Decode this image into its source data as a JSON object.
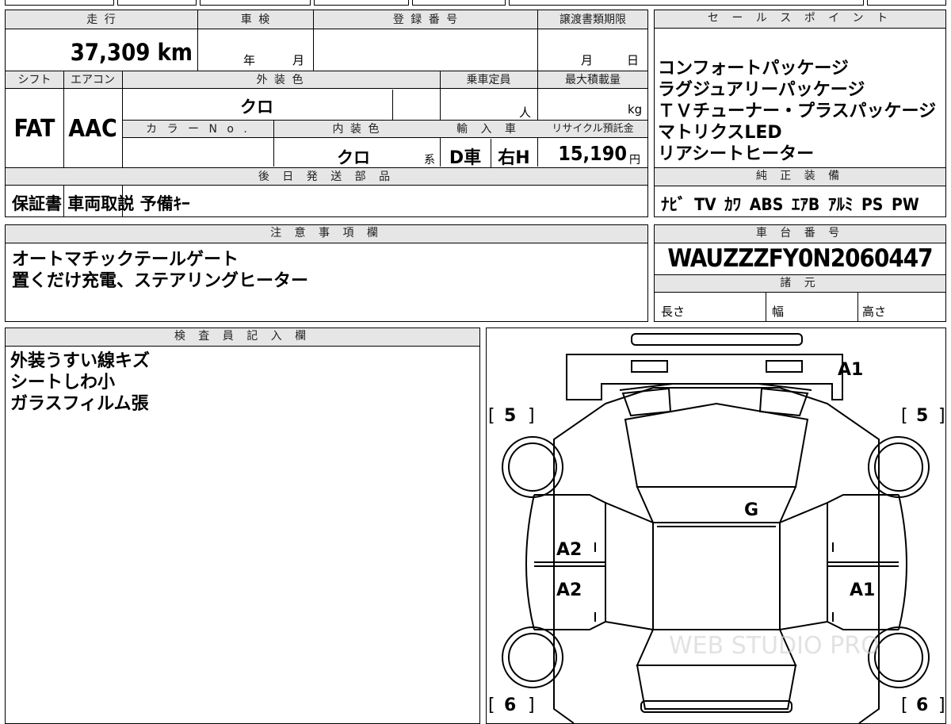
{
  "vehicle": {
    "mileage_label": "走 行",
    "mileage": "37,309 km",
    "inspection_label": "車 検",
    "inspection_year": "年",
    "inspection_month": "月",
    "registration_label": "登 録 番 号",
    "transfer_deadline_label": "譲渡書類期限",
    "transfer_month": "月",
    "transfer_day": "日",
    "shift_label": "シフト",
    "shift": "FAT",
    "aircon_label": "エアコン",
    "aircon": "AAC",
    "exterior_color_label": "外 装 色",
    "exterior_color": "クロ",
    "capacity_label": "乗車定員",
    "capacity_unit": "人",
    "max_load_label": "最大積載量",
    "max_load_unit": "kg",
    "color_no_label": "カ ラ ー N o .",
    "interior_color_label": "内 装 色",
    "interior_color": "クロ",
    "interior_suffix": "系",
    "import_label": "輸 入 車",
    "import_type": "D車",
    "steering": "右H",
    "recycle_label": "リサイクル預託金",
    "recycle_value": "15,190",
    "recycle_unit": "円"
  },
  "sales_points": {
    "title": "セ ー ル ス ポ イ ン ト",
    "items": [
      "コンフォートパッケージ",
      "ラグジュアリーパッケージ",
      "ＴＶチューナー・プラスパッケージ",
      "マトリクスLED",
      "リアシートヒーター"
    ]
  },
  "later_parts": {
    "title": "後 日 発 送 部 品",
    "value": "保証書 車両取説 予備ｷｰ"
  },
  "genuine_equipment": {
    "title": "純 正 装 備",
    "value": "ﾅﾋﾞ TV ｶﾜ ABS ｴｱB ｱﾙﾐ PS PW"
  },
  "notes": {
    "title": "注 意 事 項 欄",
    "lines": [
      "オートマチックテールゲート",
      "置くだけ充電、ステアリングヒーター"
    ]
  },
  "chassis": {
    "title": "車 台 番 号",
    "number": "WAUZZZFY0N2060447",
    "specs_title": "諸 元",
    "length_label": "長さ",
    "width_label": "幅",
    "height_label": "高さ"
  },
  "inspector": {
    "title": "検 査 員 記 入 欄",
    "lines": [
      "外装うすい線キズ",
      "シートしわ小",
      "ガラスフィルム張"
    ]
  },
  "diagram": {
    "marks": {
      "front_right": "A1",
      "roof": "G",
      "left_front_door": "A2",
      "left_rear_door": "A2",
      "right_rear_door": "A1"
    },
    "tire_front_left": "5",
    "tire_front_right": "5",
    "tire_rear_left": "6",
    "tire_rear_right": "6",
    "watermark": "WEB STUDIO PRO"
  }
}
